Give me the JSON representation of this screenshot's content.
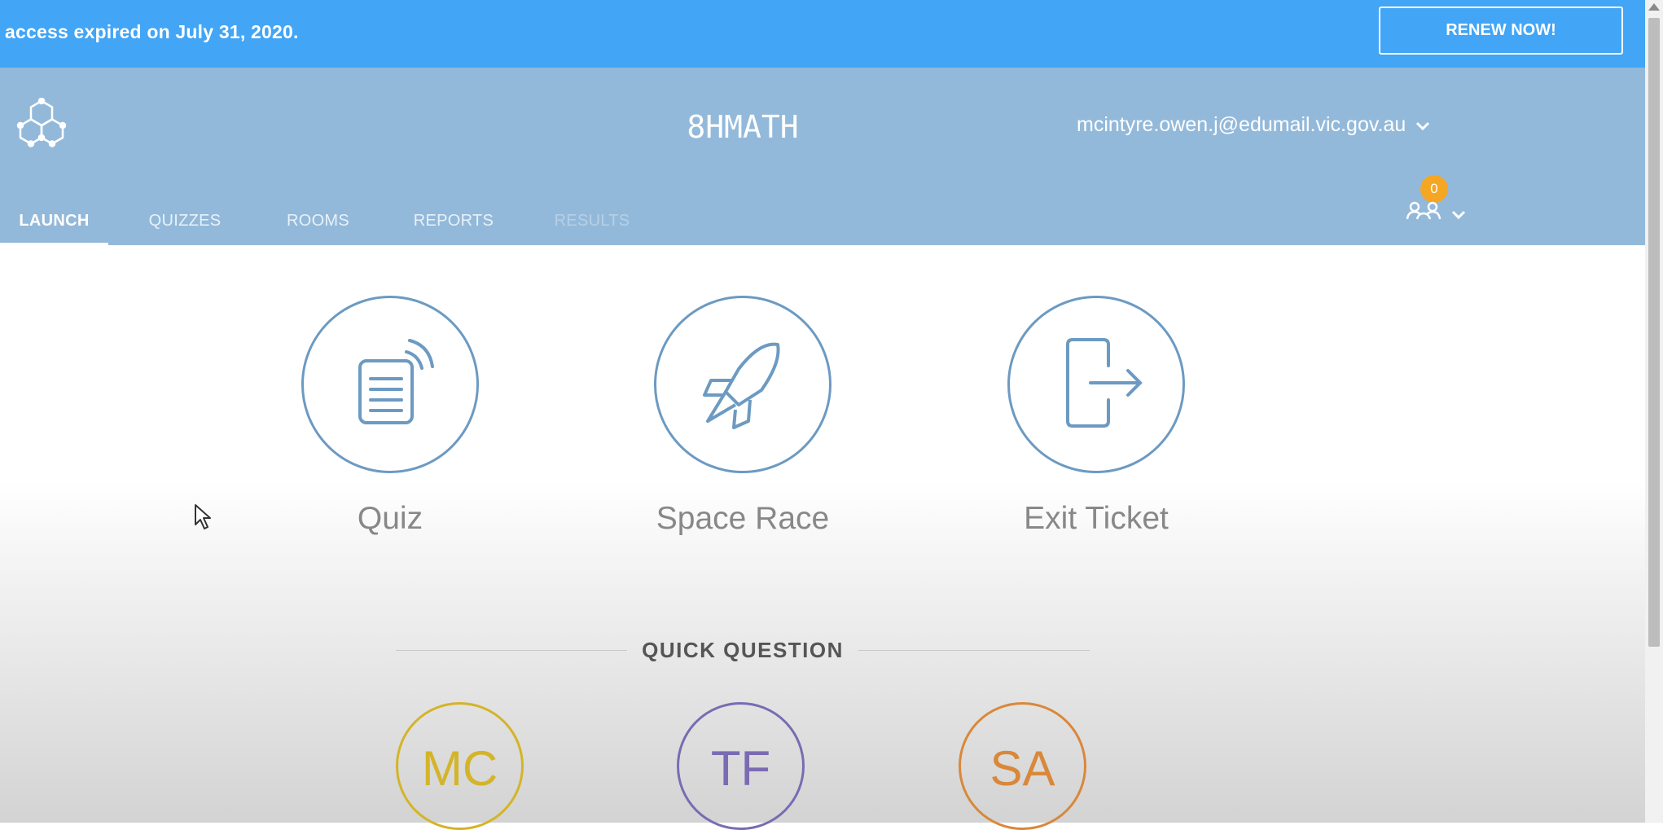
{
  "banner": {
    "message": "access expired on July 31, 2020.",
    "renew_label": "RENEW NOW!"
  },
  "header": {
    "logo_icon": "hexagon-network-icon",
    "room_name": "8HMATH",
    "user_email": "mcintyre.owen.j@edumail.vic.gov.au",
    "student_count": "0",
    "tabs": [
      {
        "label": "LAUNCH",
        "state": "active"
      },
      {
        "label": "QUIZZES",
        "state": "normal"
      },
      {
        "label": "ROOMS",
        "state": "normal"
      },
      {
        "label": "REPORTS",
        "state": "normal"
      },
      {
        "label": "RESULTS",
        "state": "disabled"
      }
    ]
  },
  "launch": {
    "items": [
      {
        "label": "Quiz",
        "icon": "quiz-broadcast-icon"
      },
      {
        "label": "Space Race",
        "icon": "rocket-icon"
      },
      {
        "label": "Exit Ticket",
        "icon": "exit-door-icon"
      }
    ]
  },
  "quick_question": {
    "title": "QUICK QUESTION",
    "items": [
      {
        "label": "MC",
        "color": "#d4b428"
      },
      {
        "label": "TF",
        "color": "#7a6bb3"
      },
      {
        "label": "SA",
        "color": "#d9883a"
      }
    ]
  },
  "colors": {
    "banner": "#42a5f5",
    "header": "#93b9da",
    "icon_stroke": "#6c9ac2",
    "badge": "#f5a623"
  }
}
